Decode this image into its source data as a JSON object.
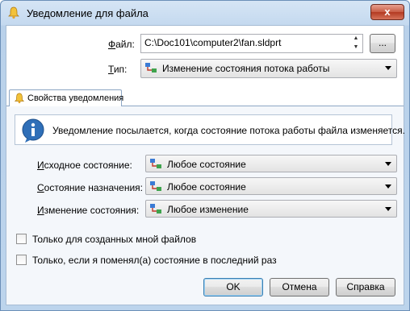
{
  "window": {
    "title": "Уведомление для файла",
    "close_glyph": "x"
  },
  "file": {
    "label_u": "Ф",
    "label_rest": "айл:",
    "value": "C:\\Doc101\\computer2\\fan.sldprt",
    "browse_label": "..."
  },
  "type": {
    "label_u": "Т",
    "label_rest": "ип:",
    "value": "Изменение состояния потока работы"
  },
  "tab": {
    "label": "Свойства уведомления"
  },
  "info": {
    "text": "Уведомление посылается, когда состояние потока работы файла изменяется."
  },
  "fields": [
    {
      "label_u": "И",
      "label_rest": "сходное состояние:",
      "value": "Любое состояние"
    },
    {
      "label_u": "С",
      "label_rest": "остояние назначения:",
      "value": "Любое состояние"
    },
    {
      "label_u": "И",
      "label_rest": "зменение состояния:",
      "value": "Любое изменение"
    }
  ],
  "checkboxes": [
    {
      "label": "Только для созданных мной файлов",
      "checked": false
    },
    {
      "label": "Только, если я поменял(а) состояние в последний раз",
      "checked": false
    }
  ],
  "buttons": {
    "ok": "OK",
    "cancel": "Отмена",
    "help": "Справка"
  },
  "colors": {
    "title_bar": "#c4d9ef",
    "close_button": "#c75b44",
    "panel": "#f4f7fb"
  },
  "icons": {
    "title": "bell-icon",
    "tab": "bell-icon",
    "info": "info-icon",
    "combo": "workflow-icon"
  }
}
